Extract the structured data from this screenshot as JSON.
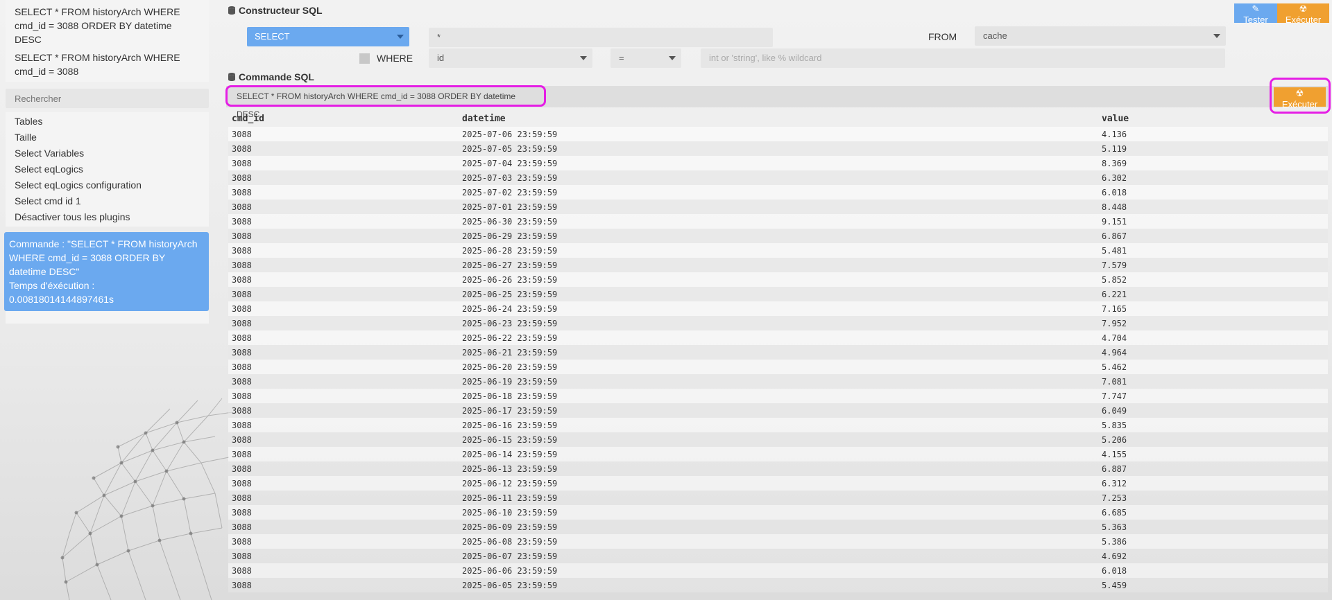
{
  "history": [
    "SELECT * FROM historyArch WHERE cmd_id = 3088 ORDER BY datetime DESC",
    "SELECT * FROM historyArch WHERE cmd_id = 3088"
  ],
  "search": {
    "placeholder": "Rechercher"
  },
  "menu": [
    "Tables",
    "Taille",
    "Select Variables",
    "Select eqLogics",
    "Select eqLogics configuration",
    "Select cmd id 1",
    "Désactiver tous les plugins"
  ],
  "info": {
    "command": "Commande : \"SELECT * FROM historyArch WHERE cmd_id = 3088 ORDER BY datetime DESC\"",
    "time_label": "Temps d'éxécution :",
    "time_value": "0.00818014144897461s"
  },
  "builder": {
    "title": "Constructeur SQL",
    "test_label": "Tester",
    "exec_label": "Exécuter",
    "select_value": "SELECT",
    "fields_value": "*",
    "from_label": "FROM",
    "from_value": "cache",
    "where_label": "WHERE",
    "where_column": "id",
    "where_operator": "=",
    "where_placeholder": "int or 'string', like % wildcard"
  },
  "command": {
    "title": "Commande SQL",
    "value": "SELECT * FROM historyArch WHERE cmd_id = 3088 ORDER BY datetime DESC",
    "exec_label": "Exécuter"
  },
  "colors": {
    "accent_blue": "#6ba9ef",
    "accent_orange": "#f0a030",
    "highlight": "#e51ee5"
  },
  "table": {
    "columns": [
      "cmd_id",
      "datetime",
      "value"
    ],
    "rows": [
      [
        "3088",
        "2025-07-06 23:59:59",
        "4.136"
      ],
      [
        "3088",
        "2025-07-05 23:59:59",
        "5.119"
      ],
      [
        "3088",
        "2025-07-04 23:59:59",
        "8.369"
      ],
      [
        "3088",
        "2025-07-03 23:59:59",
        "6.302"
      ],
      [
        "3088",
        "2025-07-02 23:59:59",
        "6.018"
      ],
      [
        "3088",
        "2025-07-01 23:59:59",
        "8.448"
      ],
      [
        "3088",
        "2025-06-30 23:59:59",
        "9.151"
      ],
      [
        "3088",
        "2025-06-29 23:59:59",
        "6.867"
      ],
      [
        "3088",
        "2025-06-28 23:59:59",
        "5.481"
      ],
      [
        "3088",
        "2025-06-27 23:59:59",
        "7.579"
      ],
      [
        "3088",
        "2025-06-26 23:59:59",
        "5.852"
      ],
      [
        "3088",
        "2025-06-25 23:59:59",
        "6.221"
      ],
      [
        "3088",
        "2025-06-24 23:59:59",
        "7.165"
      ],
      [
        "3088",
        "2025-06-23 23:59:59",
        "7.952"
      ],
      [
        "3088",
        "2025-06-22 23:59:59",
        "4.704"
      ],
      [
        "3088",
        "2025-06-21 23:59:59",
        "4.964"
      ],
      [
        "3088",
        "2025-06-20 23:59:59",
        "5.462"
      ],
      [
        "3088",
        "2025-06-19 23:59:59",
        "7.081"
      ],
      [
        "3088",
        "2025-06-18 23:59:59",
        "7.747"
      ],
      [
        "3088",
        "2025-06-17 23:59:59",
        "6.049"
      ],
      [
        "3088",
        "2025-06-16 23:59:59",
        "5.835"
      ],
      [
        "3088",
        "2025-06-15 23:59:59",
        "5.206"
      ],
      [
        "3088",
        "2025-06-14 23:59:59",
        "4.155"
      ],
      [
        "3088",
        "2025-06-13 23:59:59",
        "6.887"
      ],
      [
        "3088",
        "2025-06-12 23:59:59",
        "6.312"
      ],
      [
        "3088",
        "2025-06-11 23:59:59",
        "7.253"
      ],
      [
        "3088",
        "2025-06-10 23:59:59",
        "6.685"
      ],
      [
        "3088",
        "2025-06-09 23:59:59",
        "5.363"
      ],
      [
        "3088",
        "2025-06-08 23:59:59",
        "5.386"
      ],
      [
        "3088",
        "2025-06-07 23:59:59",
        "4.692"
      ],
      [
        "3088",
        "2025-06-06 23:59:59",
        "6.018"
      ],
      [
        "3088",
        "2025-06-05 23:59:59",
        "5.459"
      ]
    ]
  }
}
